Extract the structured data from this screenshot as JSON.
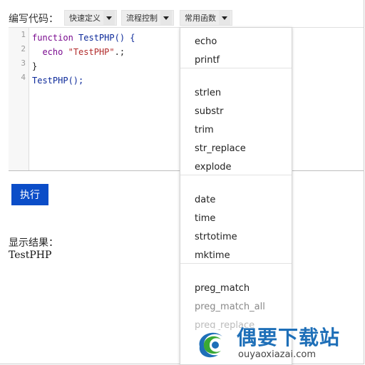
{
  "toolbar": {
    "label": "编写代码：",
    "buttons": [
      {
        "label": "快速定义"
      },
      {
        "label": "流程控制"
      },
      {
        "label": "常用函数"
      }
    ]
  },
  "editor": {
    "line_numbers": [
      "1",
      "2",
      "3",
      "4"
    ],
    "code": {
      "l1_kw": "function",
      "l1_rest": " TestPHP() {",
      "l2_indent": "  ",
      "l2_kw": "echo",
      "l2_space": " ",
      "l2_str": "\"TestPHP\"",
      "l2_rest": ".;",
      "l3": "}",
      "l4": "TestPHP();"
    }
  },
  "run_button": {
    "label": "执行"
  },
  "result": {
    "label": "显示结果：",
    "value": "TestPHP"
  },
  "dropdown": {
    "groups": [
      [
        "echo",
        "printf"
      ],
      [
        "strlen",
        "substr",
        "trim",
        "str_replace",
        "explode"
      ],
      [
        "date",
        "time",
        "strtotime",
        "mktime"
      ],
      [
        "preg_match",
        "preg_match_all",
        "preg_replace"
      ]
    ]
  },
  "watermark": {
    "title": "偶要下载站",
    "url": "ouyaoxiazai.com",
    "colors": {
      "blue": "#1e6fb8",
      "green": "#3aa935"
    }
  },
  "colors": {
    "run_button": "#0b4dc8",
    "keyword": "#7a0b8f",
    "string": "#b22c2c"
  }
}
